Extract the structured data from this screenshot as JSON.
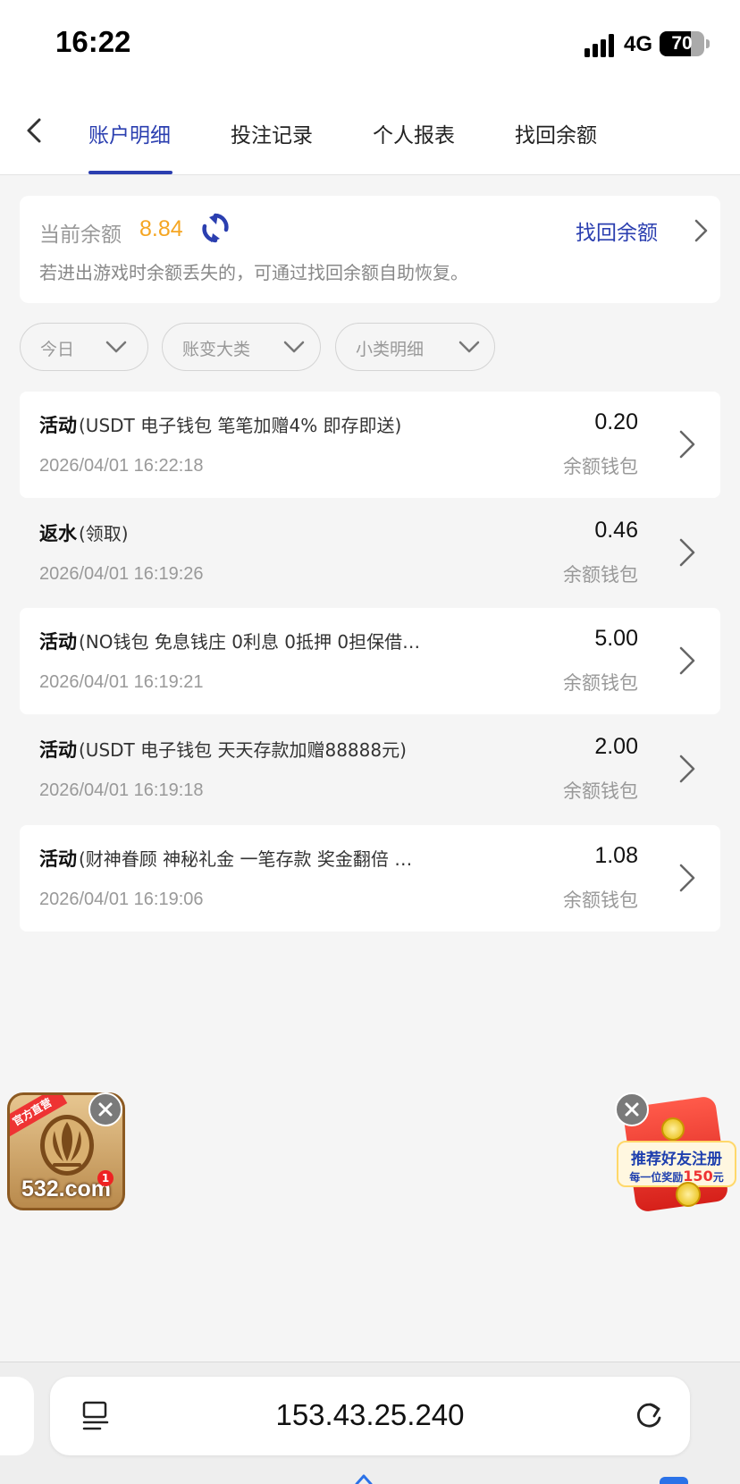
{
  "status_bar": {
    "time": "16:22",
    "network": "4G",
    "battery": "70"
  },
  "tabs": [
    {
      "label": "账户明细",
      "active": true
    },
    {
      "label": "投注记录",
      "active": false
    },
    {
      "label": "个人报表",
      "active": false
    },
    {
      "label": "找回余额",
      "active": false
    }
  ],
  "balance": {
    "label": "当前余额",
    "value": "8.84",
    "recover_link": "找回余额",
    "hint": "若进出游戏时余额丢失的，可通过找回余额自助恢复。"
  },
  "filters": [
    {
      "label": "今日"
    },
    {
      "label": "账变大类"
    },
    {
      "label": "小类明细"
    }
  ],
  "transactions": [
    {
      "type": "活动",
      "desc": "(USDT 电子钱包 笔笔加赠4% 即存即送)",
      "time": "2026/04/01 16:22:18",
      "amount": "0.20",
      "wallet": "余额钱包"
    },
    {
      "type": "返水",
      "desc": "(领取)",
      "time": "2026/04/01 16:19:26",
      "amount": "0.46",
      "wallet": "余额钱包"
    },
    {
      "type": "活动",
      "desc": "(NO钱包 免息钱庄 0利息 0抵押 0担保借…",
      "time": "2026/04/01 16:19:21",
      "amount": "5.00",
      "wallet": "余额钱包"
    },
    {
      "type": "活动",
      "desc": "(USDT 电子钱包 天天存款加赠88888元)",
      "time": "2026/04/01 16:19:18",
      "amount": "2.00",
      "wallet": "余额钱包"
    },
    {
      "type": "活动",
      "desc": "(财神眷顾 神秘礼金 一笔存款 奖金翻倍 …",
      "time": "2026/04/01 16:19:06",
      "amount": "1.08",
      "wallet": "余额钱包"
    }
  ],
  "floating_app": {
    "tag": "官方直营",
    "name": "532.com",
    "badge": "1"
  },
  "floating_promo": {
    "line1": "推荐好友注册",
    "line2_prefix": "每一位奖励",
    "line2_amount": "150",
    "line2_suffix": "元"
  },
  "browser": {
    "address": "153.43.25.240"
  },
  "colors": {
    "accent": "#2b3fb0",
    "balance": "#f5a623",
    "background": "#f5f5f5"
  },
  "icons": [
    "back-icon",
    "refresh-icon",
    "chevron-right-icon",
    "chevron-down-icon",
    "close-icon",
    "reader-icon",
    "reload-icon"
  ]
}
